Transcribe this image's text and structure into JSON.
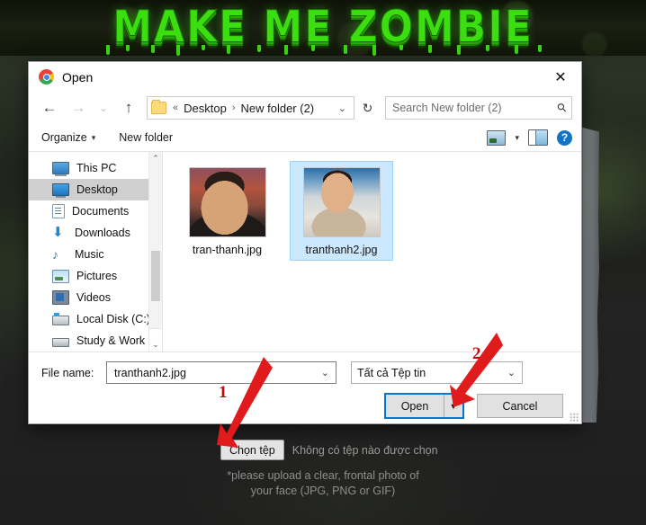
{
  "page": {
    "banner_title": "MAKE ME ZOMBIE",
    "accent_green": "#3bdf10",
    "upload_note_line1": "*please upload a clear, frontal photo of",
    "upload_note_line2": "your face (JPG, PNG or GIF)",
    "choose_file_label": "Chọn tệp",
    "no_file_text": "Không có tệp nào được chọn"
  },
  "dialog": {
    "title": "Open",
    "app_icon": "chrome-icon",
    "close_icon": "✕",
    "nav": {
      "back_icon": "←",
      "forward_icon": "→",
      "recent_icon": "⌄",
      "up_icon": "↑",
      "refresh_icon": "↻",
      "folder_icon": "folder-icon",
      "breadcrumb_prefix": "«",
      "breadcrumbs": [
        "Desktop",
        "New folder (2)"
      ],
      "breadcrumb_separator": "›",
      "address_caret": "⌄"
    },
    "search": {
      "placeholder": "Search New folder (2)",
      "value": "",
      "icon": "search-icon"
    },
    "commandbar": {
      "organize_label": "Organize",
      "organize_caret": "▾",
      "new_folder_label": "New folder",
      "view_icon": "view-icon",
      "view_caret": "▾",
      "preview_pane_icon": "preview-pane-icon",
      "help_icon": "?"
    },
    "sidebar": {
      "items": [
        {
          "label": "This PC",
          "icon": "pc-icon",
          "selected": false
        },
        {
          "label": "Desktop",
          "icon": "desktop-icon",
          "selected": true
        },
        {
          "label": "Documents",
          "icon": "documents-icon",
          "selected": false
        },
        {
          "label": "Downloads",
          "icon": "downloads-icon",
          "selected": false
        },
        {
          "label": "Music",
          "icon": "music-icon",
          "selected": false
        },
        {
          "label": "Pictures",
          "icon": "pictures-icon",
          "selected": false
        },
        {
          "label": "Videos",
          "icon": "videos-icon",
          "selected": false
        },
        {
          "label": "Local Disk (C:)",
          "icon": "disk-icon",
          "selected": false
        },
        {
          "label": "Study & Work (E",
          "icon": "disk-icon",
          "selected": false
        }
      ],
      "scroll_up_icon": "⌃",
      "scroll_down_icon": "⌄"
    },
    "files": [
      {
        "name": "tran-thanh.jpg",
        "selected": false
      },
      {
        "name": "tranthanh2.jpg",
        "selected": true
      }
    ],
    "footer": {
      "filename_label": "File name:",
      "filename_value": "tranthanh2.jpg",
      "filename_caret": "⌄",
      "filetype_value": "Tất cả Tệp tin",
      "filetype_caret": "⌄",
      "open_label": "Open",
      "open_caret": "▼",
      "cancel_label": "Cancel"
    }
  },
  "annotations": {
    "arrow_color": "#e01b1b",
    "marker_1": "1",
    "marker_2": "2"
  }
}
